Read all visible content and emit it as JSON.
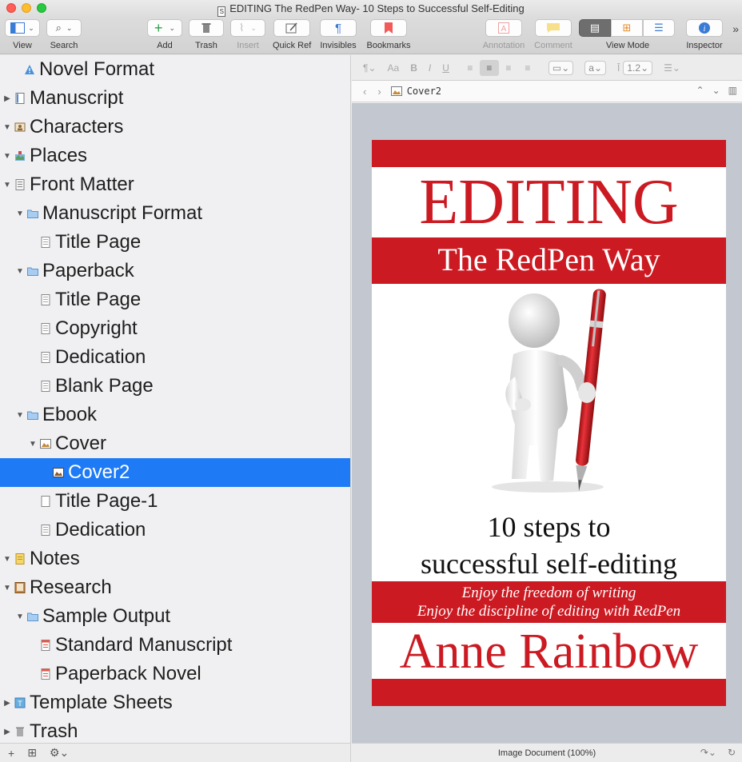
{
  "window": {
    "title": "EDITING The RedPen Way- 10 Steps to Successful Self-Editing"
  },
  "toolbar": {
    "view": "View",
    "search": "Search",
    "add": "Add",
    "trash": "Trash",
    "insert": "Insert",
    "quick_ref": "Quick Ref",
    "invisibles": "Invisibles",
    "bookmarks": "Bookmarks",
    "annotation": "Annotation",
    "comment": "Comment",
    "view_mode": "View Mode",
    "inspector": "Inspector"
  },
  "format_bar": {
    "font_size": "Aa",
    "bold": "B",
    "italic": "I",
    "underline": "U",
    "font_menu": "a",
    "line_spacing": "1.2"
  },
  "binder": {
    "items": [
      {
        "label": "Novel Format",
        "icon": "warning-icon"
      },
      {
        "label": "Manuscript",
        "icon": "manuscript-icon"
      },
      {
        "label": "Characters",
        "icon": "characters-icon"
      },
      {
        "label": "Places",
        "icon": "places-icon"
      },
      {
        "label": "Front Matter",
        "icon": "front-matter-icon"
      },
      {
        "label": "Manuscript Format",
        "icon": "folder-icon"
      },
      {
        "label": "Title Page",
        "icon": "document-icon"
      },
      {
        "label": "Paperback",
        "icon": "folder-icon"
      },
      {
        "label": "Title Page",
        "icon": "document-icon"
      },
      {
        "label": "Copyright",
        "icon": "document-icon"
      },
      {
        "label": "Dedication",
        "icon": "document-icon"
      },
      {
        "label": "Blank Page",
        "icon": "document-icon"
      },
      {
        "label": "Ebook",
        "icon": "folder-icon"
      },
      {
        "label": "Cover",
        "icon": "image-icon"
      },
      {
        "label": "Cover2",
        "icon": "image-icon"
      },
      {
        "label": "Title Page-1",
        "icon": "document-icon"
      },
      {
        "label": "Dedication",
        "icon": "document-icon"
      },
      {
        "label": "Notes",
        "icon": "notes-icon"
      },
      {
        "label": "Research",
        "icon": "research-icon"
      },
      {
        "label": "Sample Output",
        "icon": "folder-icon"
      },
      {
        "label": "Standard Manuscript",
        "icon": "pdf-icon"
      },
      {
        "label": "Paperback Novel",
        "icon": "pdf-icon"
      },
      {
        "label": "Template Sheets",
        "icon": "template-icon"
      },
      {
        "label": "Trash",
        "icon": "trash-icon"
      }
    ]
  },
  "editor": {
    "document_name": "Cover2",
    "status": "Image Document (100%)",
    "cover": {
      "title": "EDITING",
      "subtitle": "The RedPen Way",
      "tagline_1": "10 steps to",
      "tagline_2": "successful self-editing",
      "slogan_1": "Enjoy the freedom of writing",
      "slogan_2": "Enjoy the discipline of editing with RedPen",
      "author": "Anne Rainbow"
    }
  },
  "colors": {
    "selection": "#1e7bf5",
    "cover_red": "#cc1a22"
  }
}
